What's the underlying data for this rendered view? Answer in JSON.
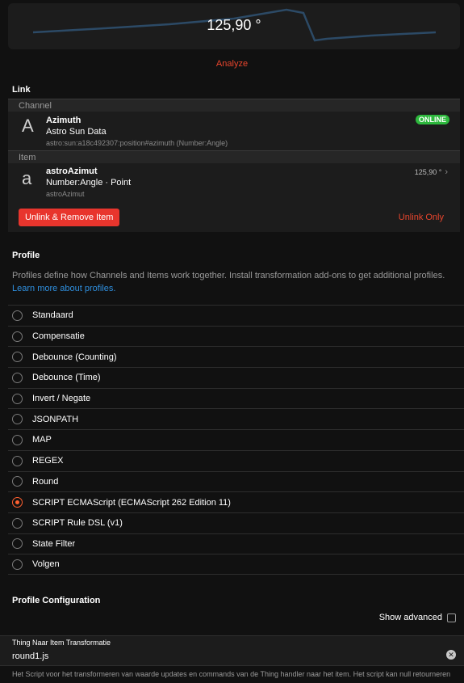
{
  "chart": {
    "value": "125,90 °",
    "analyze_label": "Analyze",
    "line_color": "#2c4a66"
  },
  "link": {
    "section_title": "Link",
    "channel": {
      "group_label": "Channel",
      "icon_letter": "A",
      "title": "Azimuth",
      "subtitle": "Astro Sun Data",
      "uid": "astro:sun:a18c492307:position#azimuth (Number:Angle)",
      "status": "ONLINE",
      "status_color": "#2db83d"
    },
    "item": {
      "group_label": "Item",
      "icon_letter": "a",
      "title": "astroAzimut",
      "subtitle": "Number:Angle · Point",
      "name": "astroAzimut",
      "state": "125,90 °"
    },
    "unlink_remove_label": "Unlink & Remove Item",
    "unlink_only_label": "Unlink Only"
  },
  "profile": {
    "section_title": "Profile",
    "description": "Profiles define how Channels and Items work together. Install transformation add-ons to get additional profiles.",
    "learn_more": "Learn more about profiles.",
    "options": [
      {
        "label": "Standaard",
        "checked": false
      },
      {
        "label": "Compensatie",
        "checked": false
      },
      {
        "label": "Debounce (Counting)",
        "checked": false
      },
      {
        "label": "Debounce (Time)",
        "checked": false
      },
      {
        "label": "Invert / Negate",
        "checked": false
      },
      {
        "label": "JSONPATH",
        "checked": false
      },
      {
        "label": "MAP",
        "checked": false
      },
      {
        "label": "REGEX",
        "checked": false
      },
      {
        "label": "Round",
        "checked": false
      },
      {
        "label": "SCRIPT ECMAScript (ECMAScript 262 Edition 11)",
        "checked": true
      },
      {
        "label": "SCRIPT Rule DSL (v1)",
        "checked": false
      },
      {
        "label": "State Filter",
        "checked": false
      },
      {
        "label": "Volgen",
        "checked": false
      }
    ]
  },
  "config": {
    "section_title": "Profile Configuration",
    "show_advanced": "Show advanced",
    "field_label": "Thing Naar Item Transformatie",
    "field_value": "round1.js",
    "field_help": "Het Script voor het transformeren van waarde updates en commands van de Thing handler naar het item. Het script kan null retourneren"
  },
  "colors": {
    "accent": "#e8452d",
    "link": "#2f8fde",
    "radio_checked": "#ff6030"
  }
}
